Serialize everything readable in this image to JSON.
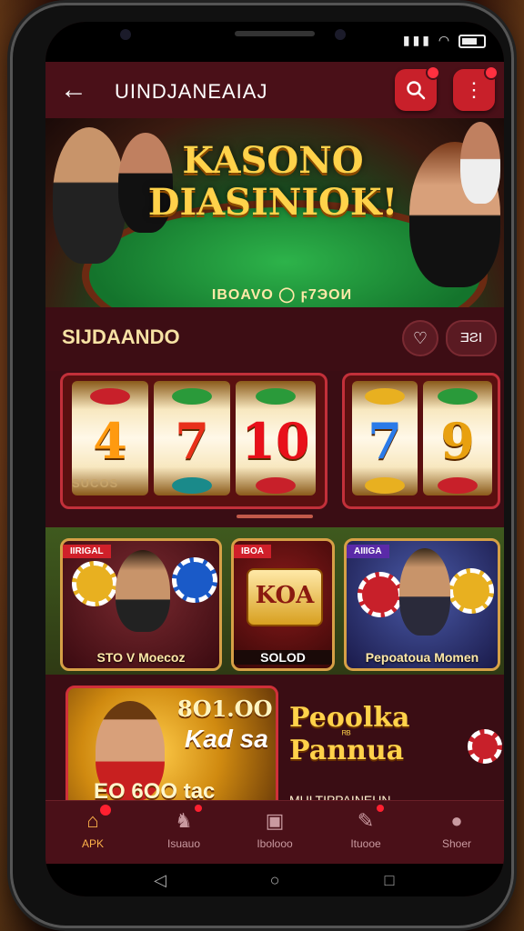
{
  "header": {
    "title": "UINDJANEAIAJ",
    "back_icon": "arrow-left-icon",
    "search_icon": "search-icon",
    "menu_icon": "more-vertical-icon"
  },
  "banner": {
    "title_line1": "KASONO",
    "title_line2": "DIASINIOK!",
    "subtitle": "IBOAVO ◯ ϝ7ЭOИ"
  },
  "section": {
    "title": "SIJDAANDO",
    "count": "ƎƧI"
  },
  "slots": [
    {
      "reels": [
        "4",
        "7",
        "10"
      ],
      "label": "SUCOS"
    },
    {
      "reels": [
        "7",
        "9"
      ],
      "label": ""
    }
  ],
  "games": [
    {
      "ribbon": "IIRIGAL",
      "label": "STO V Moecoz"
    },
    {
      "ribbon": "IBOA",
      "title": "KOA",
      "label": "SOLOD"
    },
    {
      "ribbon": "AIIIGA",
      "label": "Pepoatoua Momen"
    }
  ],
  "promo": {
    "top": "8O1.OO",
    "mid": "Kad sa",
    "bottom": "EO 6OO tac",
    "side_title_1": "Peoolka",
    "side_small": "ᴿᴮ",
    "side_title_2": "Pannua",
    "side_sub": "MULTIPPAINEUN"
  },
  "nav": [
    {
      "label": "APK",
      "icon": "home-icon",
      "active": true
    },
    {
      "label": "Isuauo",
      "icon": "piggy-bank-icon",
      "active": false
    },
    {
      "label": "Ibolooo",
      "icon": "gift-box-icon",
      "active": false
    },
    {
      "label": "Ituooe",
      "icon": "megaphone-icon",
      "active": false
    },
    {
      "label": "Shoer",
      "icon": "user-icon",
      "active": false
    }
  ],
  "colors": {
    "accent_red": "#c8202a",
    "gold": "#ffd24a",
    "appbar": "#4a1018",
    "active_nav": "#ffb34a"
  }
}
